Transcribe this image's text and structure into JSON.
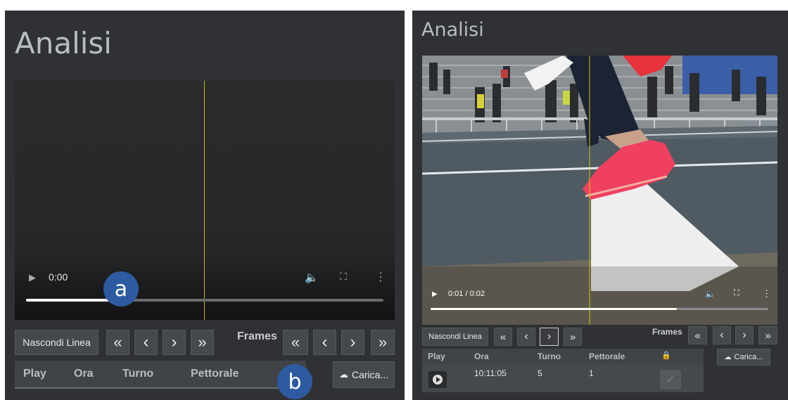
{
  "left": {
    "title": "Analisi",
    "video": {
      "time": "0:00",
      "progress": 0.3
    },
    "buttons": {
      "hide_line": "Nascondi Linea",
      "upload": "Carica..."
    },
    "nav_glyphs": {
      "fast_back": "«",
      "back": "‹",
      "forward": "›",
      "fast_forward": "»"
    },
    "frames_label": "Frames",
    "table_headers": [
      "Play",
      "Ora",
      "Turno",
      "Pettorale"
    ],
    "badges": {
      "a": "a",
      "b": "b"
    }
  },
  "right": {
    "title": "Analisi",
    "video": {
      "time": "0:01 / 0:02",
      "progress": 0.73
    },
    "buttons": {
      "hide_line": "Nascondi Linea",
      "upload": "Carica..."
    },
    "frames_label": "Frames",
    "table_headers": [
      "Play",
      "Ora",
      "Turno",
      "Pettorale"
    ],
    "rows": [
      {
        "ora": "10:11:05",
        "turno": "5",
        "pettorale": "1"
      }
    ]
  },
  "colors": {
    "panel_bg": "#2f3134",
    "guide_line": "#c8b400",
    "badge": "#2d5aa0",
    "shoe": "#ef4060"
  }
}
